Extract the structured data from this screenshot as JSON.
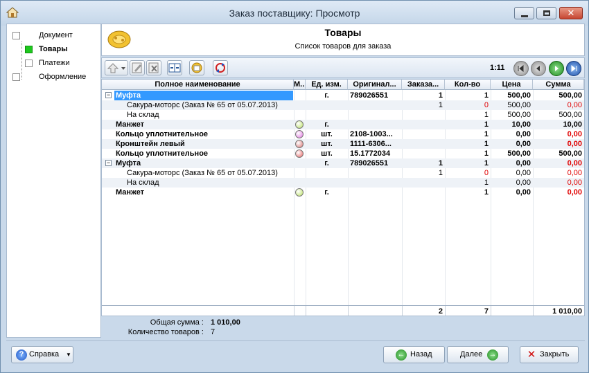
{
  "window": {
    "title": "Заказ поставщику: Просмотр",
    "app_icon": "home-icon",
    "controls": [
      "minimize-icon",
      "maximize-icon",
      "close-icon"
    ]
  },
  "sidebar": {
    "steps": [
      {
        "label": "Документ",
        "active": false
      },
      {
        "label": "Товары",
        "active": true
      },
      {
        "label": "Платежи",
        "active": false
      },
      {
        "label": "Оформление",
        "active": false
      }
    ]
  },
  "header": {
    "title": "Товары",
    "subtitle": "Список товаров для заказа",
    "icon": "box-icon"
  },
  "toolbar": {
    "buttons": [
      "move-up-dropdown-icon",
      "edit-icon",
      "delete-icon",
      "split-columns-icon",
      "folder-icon",
      "refresh-icon"
    ],
    "counter": "1:11",
    "nav": [
      "first-icon",
      "prev-icon",
      "next-icon",
      "last-icon"
    ]
  },
  "grid": {
    "columns": {
      "name": "Полное наименование",
      "mark": "М...",
      "unit": "Ед. изм.",
      "original": "Оригинал...",
      "ordered": "Заказа...",
      "qty": "Кол-во",
      "price": "Цена",
      "sum": "Сумма"
    },
    "rows": [
      {
        "level": 0,
        "expander": "−",
        "name": "Муфта",
        "dot": "",
        "unit": "г.",
        "original": "789026551",
        "ordered": "1",
        "qty": "1",
        "price": "500,00",
        "sum": "500,00",
        "sum_red": false,
        "qty_red": false,
        "selected": true
      },
      {
        "level": 1,
        "expander": "",
        "name": "Сакура-моторс (Заказ № 65 от 05.07.2013)",
        "dot": "",
        "unit": "",
        "original": "",
        "ordered": "1",
        "qty": "0",
        "price": "500,00",
        "sum": "0,00",
        "sum_red": true,
        "qty_red": true,
        "selected": false
      },
      {
        "level": 1,
        "expander": "",
        "name": "На склад",
        "dot": "",
        "unit": "",
        "original": "",
        "ordered": "",
        "qty": "1",
        "price": "500,00",
        "sum": "500,00",
        "sum_red": false,
        "qty_red": false,
        "selected": false
      },
      {
        "level": 0,
        "expander": "",
        "name": "Манжет",
        "dot": "#b8e060",
        "unit": "г.",
        "original": "",
        "ordered": "",
        "qty": "1",
        "price": "10,00",
        "sum": "10,00",
        "sum_red": false,
        "qty_red": false,
        "selected": false
      },
      {
        "level": 0,
        "expander": "",
        "name": "Кольцо уплотнительное",
        "dot": "#e070e0",
        "unit": "шт.",
        "original": "2108-1003...",
        "ordered": "",
        "qty": "1",
        "price": "0,00",
        "sum": "0,00",
        "sum_red": true,
        "qty_red": false,
        "selected": false
      },
      {
        "level": 0,
        "expander": "",
        "name": "Кронштейн левый",
        "dot": "#d87070",
        "unit": "шт.",
        "original": "1111-6306...",
        "ordered": "",
        "qty": "1",
        "price": "0,00",
        "sum": "0,00",
        "sum_red": true,
        "qty_red": false,
        "selected": false
      },
      {
        "level": 0,
        "expander": "",
        "name": "Кольцо уплотнительное",
        "dot": "#e86060",
        "unit": "шт.",
        "original": "15.1772034",
        "ordered": "",
        "qty": "1",
        "price": "500,00",
        "sum": "500,00",
        "sum_red": false,
        "qty_red": false,
        "selected": false
      },
      {
        "level": 0,
        "expander": "−",
        "name": "Муфта",
        "dot": "",
        "unit": "г.",
        "original": "789026551",
        "ordered": "1",
        "qty": "1",
        "price": "0,00",
        "sum": "0,00",
        "sum_red": true,
        "qty_red": false,
        "selected": false
      },
      {
        "level": 1,
        "expander": "",
        "name": "Сакура-моторс (Заказ № 65 от 05.07.2013)",
        "dot": "",
        "unit": "",
        "original": "",
        "ordered": "1",
        "qty": "0",
        "price": "0,00",
        "sum": "0,00",
        "sum_red": true,
        "qty_red": true,
        "selected": false
      },
      {
        "level": 1,
        "expander": "",
        "name": "На склад",
        "dot": "",
        "unit": "",
        "original": "",
        "ordered": "",
        "qty": "1",
        "price": "0,00",
        "sum": "0,00",
        "sum_red": true,
        "qty_red": false,
        "selected": false
      },
      {
        "level": 0,
        "expander": "",
        "name": "Манжет",
        "dot": "#b8e060",
        "unit": "г.",
        "original": "",
        "ordered": "",
        "qty": "1",
        "price": "0,00",
        "sum": "0,00",
        "sum_red": true,
        "qty_red": false,
        "selected": false
      }
    ],
    "totals": {
      "ordered": "2",
      "qty": "7",
      "sum": "1 010,00"
    }
  },
  "summary": {
    "total_sum_label": "Общая сумма :",
    "total_sum_value": "1 010,00",
    "count_label": "Количество товаров :",
    "count_value": "7"
  },
  "bottom": {
    "help": "Справка",
    "back": "Назад",
    "next": "Далее",
    "close": "Закрыть"
  }
}
